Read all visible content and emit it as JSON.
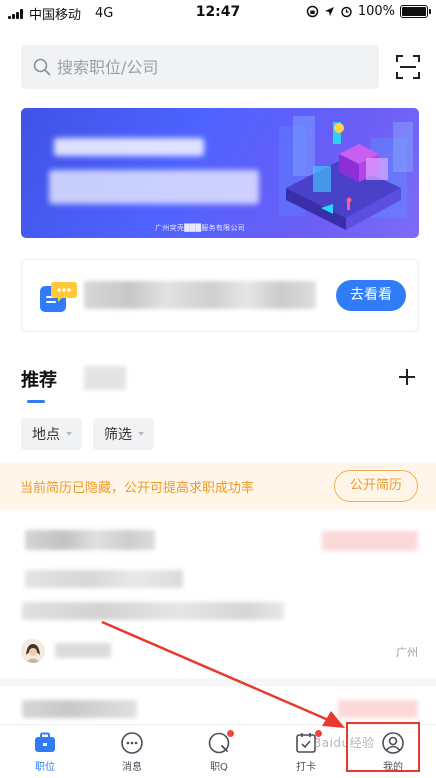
{
  "status_bar": {
    "carrier": "中国移动",
    "network": "4G",
    "time": "12:47",
    "battery_percent": "100%"
  },
  "search": {
    "placeholder": "搜索职位/公司"
  },
  "banner": {
    "caption": "广州突壳███服务有限公司",
    "colors": {
      "start": "#3f53e6",
      "end": "#7d6cf7"
    }
  },
  "promo": {
    "button_label": "去看看"
  },
  "recommend": {
    "title": "推荐",
    "filters": [
      {
        "label": "地点"
      },
      {
        "label": "筛选"
      }
    ]
  },
  "notice": {
    "text": "当前简历已隐藏，公开可提高求职成功率",
    "button_label": "公开简历"
  },
  "job_card": {
    "location": "广州"
  },
  "bottom_nav": {
    "items": [
      {
        "label": "职位",
        "icon": "briefcase-icon",
        "active": true,
        "badge": false
      },
      {
        "label": "消息",
        "icon": "chat-icon",
        "active": false,
        "badge": false
      },
      {
        "label": "职Q",
        "icon": "question-chat-icon",
        "active": false,
        "badge": true
      },
      {
        "label": "打卡",
        "icon": "calendar-check-icon",
        "active": false,
        "badge": true
      },
      {
        "label": "我的",
        "icon": "user-icon",
        "active": false,
        "badge": false
      }
    ]
  },
  "watermark": "Baidu经验",
  "colors": {
    "accent": "#2f7cf6",
    "notice_text": "#ee9a2a",
    "notice_bg": "#fff6e9",
    "badge": "#f5453c",
    "annotation": "#e8392e"
  }
}
